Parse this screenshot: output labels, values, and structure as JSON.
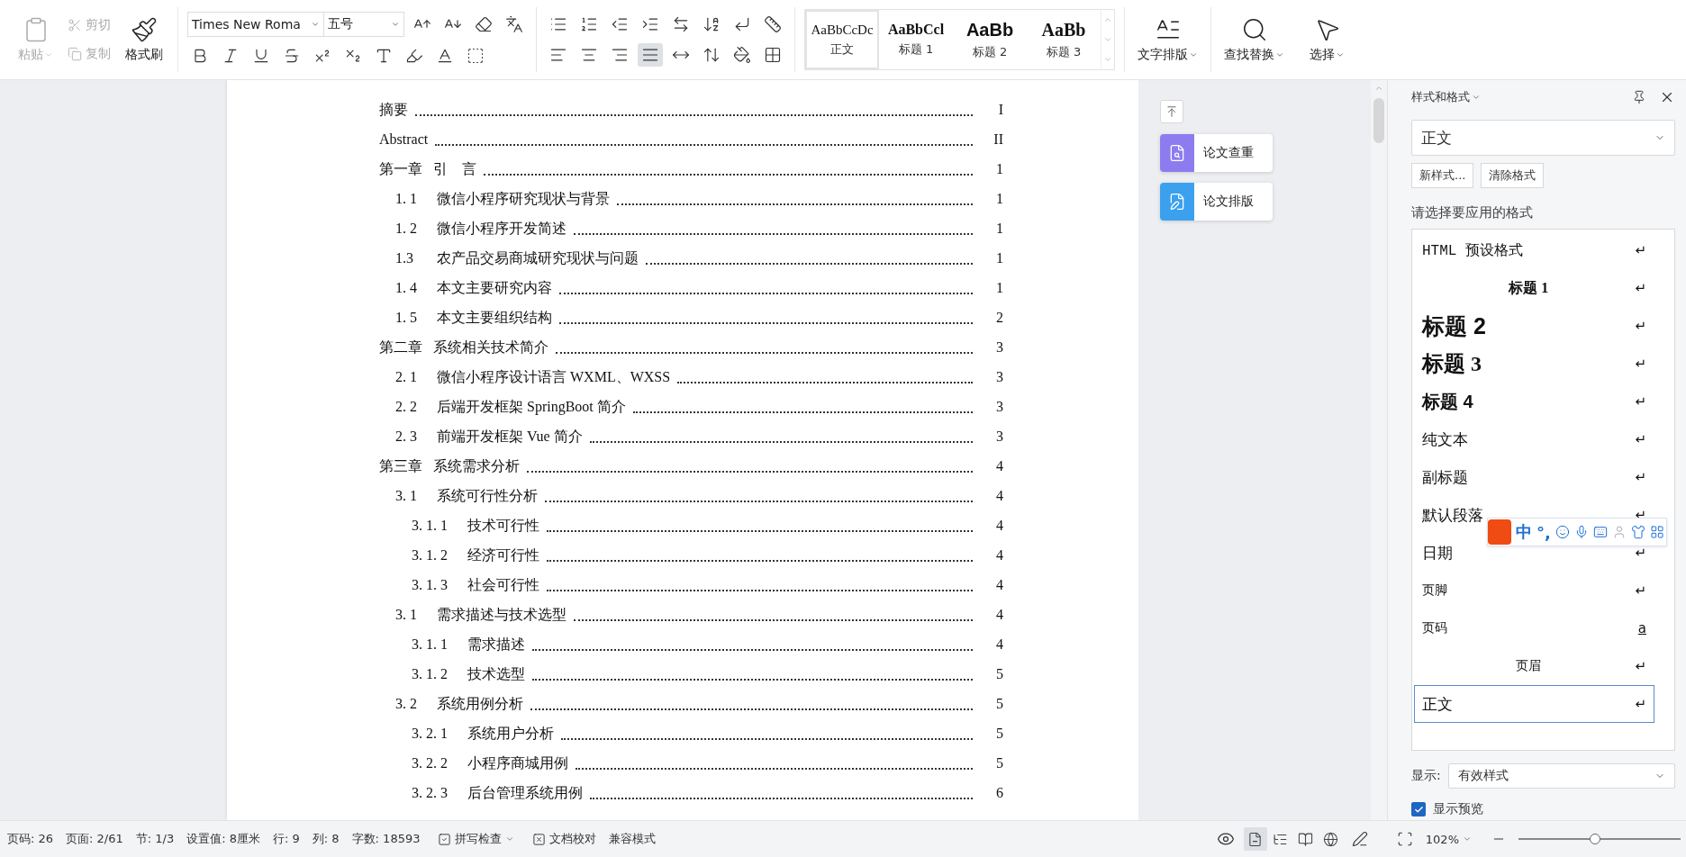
{
  "toolbar": {
    "clipboard": [
      {
        "label": "粘贴",
        "disabled": true
      },
      {
        "label": "剪切",
        "disabled": true
      },
      {
        "label": "复制",
        "disabled": true
      },
      {
        "label": "格式刷",
        "disabled": false
      }
    ],
    "font": {
      "name": "Times New Roma",
      "size": "五号"
    },
    "alignment": [
      {
        "selected": false
      },
      {
        "selected": false
      },
      {
        "selected": false
      },
      {
        "selected": true
      },
      {
        "selected": false
      }
    ],
    "styles": [
      {
        "preview": "AaBbCcDc",
        "label": "正文",
        "kind": "body",
        "selected": true
      },
      {
        "preview": "AaBbCcl",
        "label": "标题 1",
        "kind": "h1",
        "selected": false
      },
      {
        "preview": "AaBb",
        "label": "标题 2",
        "kind": "h2",
        "selected": false
      },
      {
        "preview": "AaBb",
        "label": "标题 3",
        "kind": "h3",
        "selected": false
      }
    ],
    "actions": [
      {
        "label": "文字排版"
      },
      {
        "label": "查找替换"
      },
      {
        "label": "选择"
      }
    ]
  },
  "toc": [
    {
      "title": "摘要",
      "page": "I"
    },
    {
      "title": "Abstract",
      "page": "II"
    },
    {
      "number": "第一章",
      "title": "引　言",
      "page": "1",
      "children": [
        {
          "number": "1. 1",
          "title": "微信小程序研究现状与背景",
          "page": "1"
        },
        {
          "number": "1. 2",
          "title": "微信小程序开发简述",
          "page": "1"
        },
        {
          "number": "1.3",
          "title": "农产品交易商城研究现状与问题",
          "page": "1"
        },
        {
          "number": "1. 4",
          "title": "本文主要研究内容",
          "page": "1"
        },
        {
          "number": "1. 5",
          "title": "本文主要组织结构",
          "page": "2"
        }
      ]
    },
    {
      "number": "第二章",
      "title": "系统相关技术简介",
      "page": "3",
      "children": [
        {
          "number": "2. 1",
          "title": "微信小程序设计语言 WXML、WXSS",
          "page": "3"
        },
        {
          "number": "2. 2",
          "title": "后端开发框架 SpringBoot 简介",
          "page": "3"
        },
        {
          "number": "2. 3",
          "title": "前端开发框架 Vue 简介",
          "page": "3"
        }
      ]
    },
    {
      "number": "第三章",
      "title": "系统需求分析",
      "page": "4",
      "children": [
        {
          "number": "3. 1",
          "title": "系统可行性分析",
          "page": "4",
          "children": [
            {
              "number": "3. 1. 1",
              "title": "技术可行性",
              "page": "4"
            },
            {
              "number": "3. 1. 2",
              "title": "经济可行性",
              "page": "4"
            },
            {
              "number": "3. 1. 3",
              "title": "社会可行性",
              "page": "4"
            }
          ]
        },
        {
          "number": "3. 1",
          "title": "需求描述与技术选型",
          "page": "4",
          "children": [
            {
              "number": "3. 1. 1",
              "title": "需求描述",
              "page": "4"
            },
            {
              "number": "3. 1. 2",
              "title": "技术选型",
              "page": "5"
            }
          ]
        },
        {
          "number": "3. 2",
          "title": "系统用例分析",
          "page": "5",
          "children": [
            {
              "number": "3. 2. 1",
              "title": "系统用户分析",
              "page": "5"
            },
            {
              "number": "3. 2. 2",
              "title": "小程序商城用例",
              "page": "5"
            },
            {
              "number": "3. 2. 3",
              "title": "后台管理系统用例",
              "page": "6"
            }
          ]
        }
      ]
    }
  ],
  "side_buttons": [
    {
      "label": "论文查重"
    },
    {
      "label": "论文排版"
    }
  ],
  "style_panel": {
    "title": "样式和格式",
    "current": "正文",
    "buttons": [
      "新样式...",
      "清除格式"
    ],
    "prompt": "请选择要应用的格式",
    "items": [
      {
        "label": "HTML 预设格式",
        "kind": "mono",
        "marker": "↵",
        "selected": false
      },
      {
        "label": "标题 1",
        "kind": "h1",
        "marker": "↵",
        "selected": false
      },
      {
        "label": "标题 2",
        "kind": "h2",
        "marker": "↵",
        "selected": false
      },
      {
        "label": "标题 3",
        "kind": "h3",
        "marker": "↵",
        "selected": false
      },
      {
        "label": "标题 4",
        "kind": "h4",
        "marker": "↵",
        "selected": false
      },
      {
        "label": "纯文本",
        "kind": "serif",
        "marker": "↵",
        "selected": false
      },
      {
        "label": "副标题",
        "kind": "serif",
        "marker": "↵",
        "selected": false
      },
      {
        "label": "默认段落",
        "kind": "serif",
        "marker": "↵",
        "selected": false
      },
      {
        "label": "日期",
        "kind": "serif",
        "marker": "↵",
        "selected": false
      },
      {
        "label": "页脚",
        "kind": "small",
        "marker": "↵",
        "selected": false
      },
      {
        "label": "页码",
        "kind": "small",
        "marker": "a",
        "selected": false
      },
      {
        "label": "页眉",
        "kind": "centered",
        "marker": "↵",
        "selected": false
      },
      {
        "label": "正文",
        "kind": "serif",
        "marker": "↵",
        "selected": true
      }
    ],
    "show_label": "显示:",
    "show_value": "有效样式",
    "preview": {
      "label": "显示预览",
      "checked": true
    }
  },
  "ime_bar": {
    "mode": "中",
    "punct": "°,"
  },
  "status_bar": {
    "items": [
      "页码: 26",
      "页面: 2/61",
      "节: 1/3",
      "设置值: 8厘米",
      "行: 9",
      "列: 8",
      "字数: 18593"
    ],
    "spell": "拼写检查",
    "proofread": "文档校对",
    "compat": "兼容模式",
    "views": [
      {
        "selected": true
      },
      {
        "selected": false
      },
      {
        "selected": false
      },
      {
        "selected": false
      }
    ],
    "zoom": "102%",
    "zoom_slider": {
      "level": 0.47
    }
  }
}
